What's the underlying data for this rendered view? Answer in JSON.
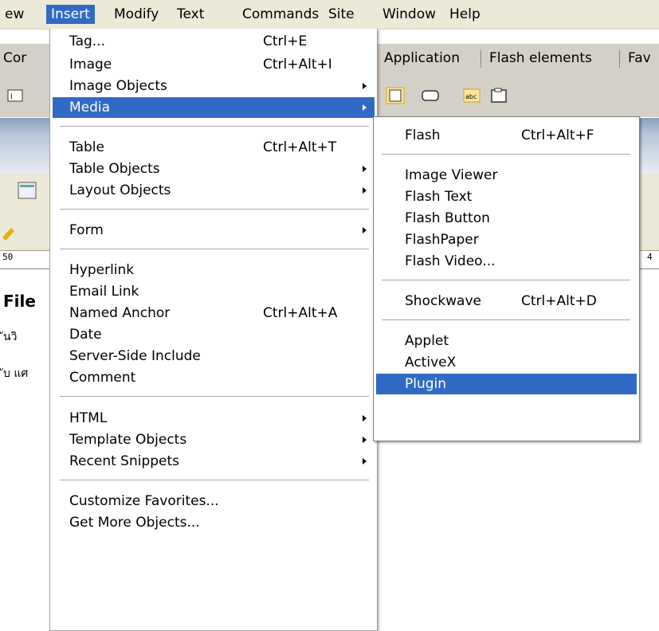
{
  "menubar": {
    "items": [
      "ew",
      "Insert",
      "Modify",
      "Text",
      "Commands",
      "Site",
      "Window",
      "Help"
    ]
  },
  "insertbar": {
    "tab_left": "Cor",
    "tab_app": "Application",
    "tab_flash": "Flash elements",
    "tab_fav": "Fav"
  },
  "ruler": {
    "left": "50",
    "right": "4"
  },
  "document": {
    "heading": "File",
    "line1": "ันวิ",
    "line2": "ับ แศ"
  },
  "insert_menu": {
    "tag": {
      "label": "Tag...",
      "shortcut": "Ctrl+E"
    },
    "image": {
      "label": "Image",
      "shortcut": "Ctrl+Alt+I"
    },
    "image_objects": {
      "label": "Image Objects"
    },
    "media": {
      "label": "Media"
    },
    "table": {
      "label": "Table",
      "shortcut": "Ctrl+Alt+T"
    },
    "table_objects": {
      "label": "Table Objects"
    },
    "layout_objects": {
      "label": "Layout Objects"
    },
    "form": {
      "label": "Form"
    },
    "hyperlink": {
      "label": "Hyperlink"
    },
    "email_link": {
      "label": "Email Link"
    },
    "named_anchor": {
      "label": "Named Anchor",
      "shortcut": "Ctrl+Alt+A"
    },
    "date": {
      "label": "Date"
    },
    "ssi": {
      "label": "Server-Side Include"
    },
    "comment": {
      "label": "Comment"
    },
    "html": {
      "label": "HTML"
    },
    "template_objects": {
      "label": "Template Objects"
    },
    "recent_snippets": {
      "label": "Recent Snippets"
    },
    "customize_favorites": {
      "label": "Customize Favorites..."
    },
    "get_more_objects": {
      "label": "Get More Objects..."
    }
  },
  "media_menu": {
    "flash": {
      "label": "Flash",
      "shortcut": "Ctrl+Alt+F"
    },
    "image_viewer": {
      "label": "Image Viewer"
    },
    "flash_text": {
      "label": "Flash Text"
    },
    "flash_button": {
      "label": "Flash Button"
    },
    "flashpaper": {
      "label": "FlashPaper"
    },
    "flash_video": {
      "label": "Flash Video..."
    },
    "shockwave": {
      "label": "Shockwave",
      "shortcut": "Ctrl+Alt+D"
    },
    "applet": {
      "label": "Applet"
    },
    "activex": {
      "label": "ActiveX"
    },
    "plugin": {
      "label": "Plugin"
    }
  },
  "colors": {
    "highlight": "#316ac5",
    "menu_bg": "#ffffff",
    "chrome": "#ece9d8"
  }
}
